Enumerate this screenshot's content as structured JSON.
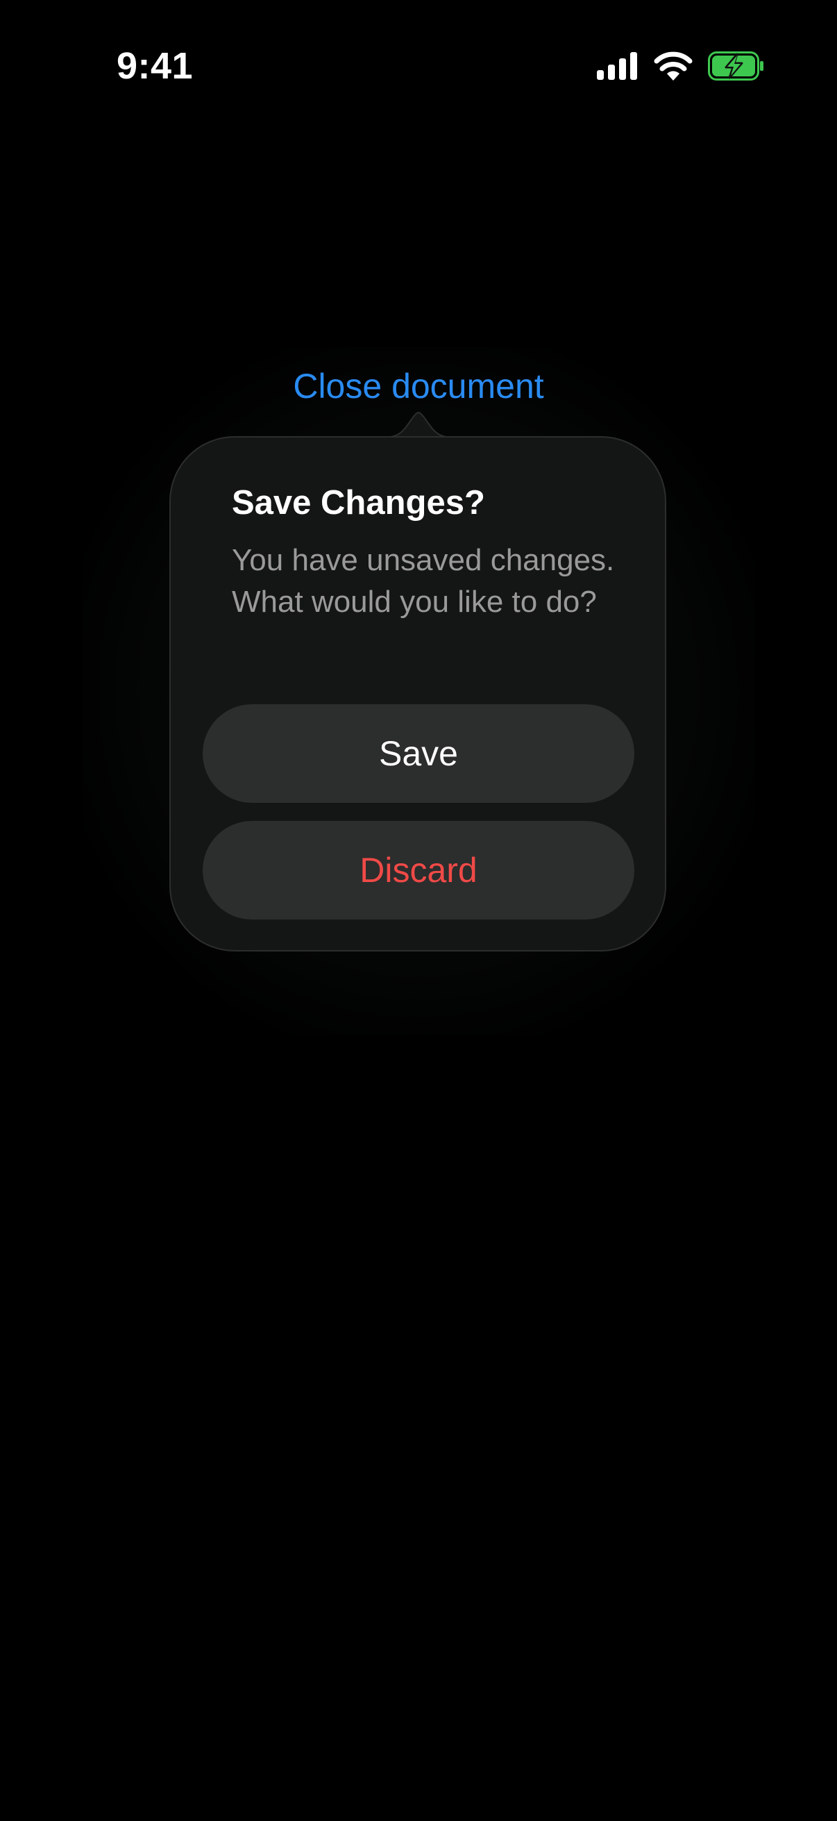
{
  "status_bar": {
    "time": "9:41",
    "icons": [
      "cellular-signal-icon",
      "wifi-icon",
      "battery-charging-icon"
    ],
    "battery_color": "#3ec74f"
  },
  "anchor": {
    "label": "Close document",
    "color": "#2a8bf2"
  },
  "dialog": {
    "title": "Save Changes?",
    "message": "You have unsaved changes. What would you like to do?",
    "buttons": {
      "save_label": "Save",
      "discard_label": "Discard"
    },
    "discard_color": "#f04a47"
  }
}
